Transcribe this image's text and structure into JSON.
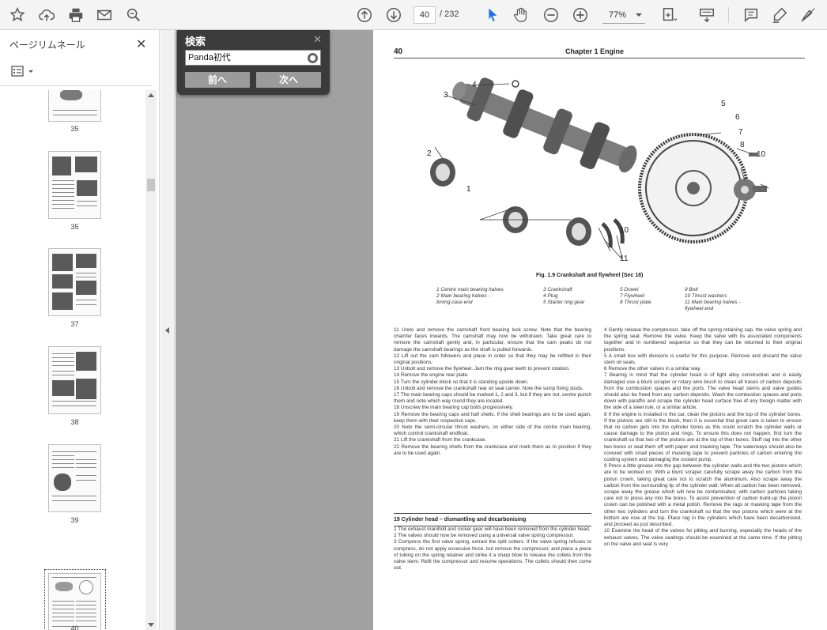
{
  "toolbar": {
    "page_current": "40",
    "page_total": "/ 232",
    "zoom": "77%"
  },
  "left_panel": {
    "title": "ページリムネール",
    "thumbnails": [
      {
        "label": "35"
      },
      {
        "label": "35"
      },
      {
        "label": "37"
      },
      {
        "label": "38"
      },
      {
        "label": "39"
      },
      {
        "label": "40"
      }
    ]
  },
  "search": {
    "title": "検索",
    "query": "Panda初代",
    "prev_label": "前へ",
    "next_label": "次へ"
  },
  "document": {
    "page_number": "40",
    "chapter": "Chapter 1  Engine",
    "figure_caption": "Fig. 1.9 Crankshaft and flywheel (Sec 18)",
    "callouts": [
      "4",
      "3",
      "2",
      "1",
      "5",
      "6",
      "7",
      "8",
      "10",
      "10",
      "11"
    ],
    "legend": [
      "1   Centre main bearing halves",
      "2   Main bearing halves -",
      "     timing case end",
      "3   Crankshaft",
      "4   Plug",
      "5   Starter ring gear",
      "5   Dowel",
      "7   Flywheel",
      "8   Thrust plate",
      "9   Bolt",
      "10  Thrust washers",
      "11  Main bearing halves -",
      "      flywheel end"
    ],
    "left_col_top": "11 Undo and remove the camshaft front bearing lock screw. Note that the bearing chamfer faces inwards. The camshaft may now be withdrawn. Take great care to remove the camshaft gently and, in particular, ensure that the cam peaks do not damage the camshaft bearings as the shaft is pulled forwards.\n12 Lift out the cam followers and place in order so that they may be refitted in their original positions.\n13 Unbolt and remove the flywheel. Jam the ring gear teeth to prevent rotation.\n14 Remove the engine rear plate.\n15 Turn the cylinder block so that it is standing upside down.\n16 Unbolt and remove the crankshaft rear oil seal carrier. Note the sump fixing studs.\n17 The main bearing caps should be marked 1, 2 and 3, but if they are not, centre punch them and note which way round they are located.\n18 Unscrew the main bearing cap bolts progressively.\n19 Remove the bearing caps and half shells. If the shell bearings are to be used again, keep them with their respective caps.\n20 Note the semi-circular thrust washers, on either side of the centre main bearing, which control crankshaft endfloat.\n21 Lift the crankshaft from the crankcase.\n22 Remove the bearing shells from the crankcase and mark them as to position if they are to be used again.",
    "section_heading": "19  Cylinder head – dismantling and decarbonising",
    "left_col_bottom": "1   The exhaust manifold and rocker gear will have been removed from the cylinder head.\n2   The valves should now be removed using a universal valve spring compressor.\n3   Compress the first valve spring, extract the split cotters. If the valve spring refuses to compress, do not apply excessive force, but remove the compressor, and place a piece of tubing on the spring retainer and strike it a sharp blow to release the collets from the valve stem. Refit the compressor and resume operations. The collets should then come out.",
    "right_col": "4   Gently release the compressor, take off the spring retaining cap, the valve spring and the spring seat. Remove the valve. Keep the valve with its associated components together and in numbered sequence so that they can be returned to their original positions.\n5   A small box with divisions is useful for this purpose. Remove and discard the valve stem oil seals.\n6   Remove the other valves in a similar way.\n7   Bearing in mind that the cylinder head is of light alloy construction and is easily damaged use a blunt scraper or rotary wire brush to clean all traces of carbon deposits from the combustion spaces and the ports. The valve head stems and valve guides should also be freed from any carbon deposits. Wash the combustion spaces and ports down with paraffin and scrape the cylinder head surface free of any foreign matter with the side of a steel rule, or a similar article.\n8   If the engine is installed in the car, clean the pistons and the top of the cylinder bores. If the pistons are still in the block, then it is essential that great care is taken to ensure that no carbon gets into the cylinder bores as this could scratch the cylinder walls or cause damage to the piston and rings. To ensure this does not happen, first turn the crankshaft so that two of the pistons are at the top of their bores. Stuff rag into the other two bores or seal them off with paper and masking tape. The waterways should also be covered with small pieces of masking tape to prevent particles of carbon entering the cooling system and damaging the coolant pump.\n9   Press a little grease into the gap between the cylinder walls and the two pistons which are to be worked on. With a blunt scraper carefully scrape away the carbon from the piston crown, taking great care not to scratch the aluminium. Also scrape away the carbon from the surrounding lip of the cylinder wall. When all carbon has been removed, scrape away the grease which will now be contaminated, with carbon particles taking care not to press any into the bores. To assist prevention of carbon build-up the piston crown can be polished with a metal polish. Remove the rags or masking tape from the other two cylinders and turn the crankshaft so that the two pistons which were at the bottom are now at the top. Place rag in the cylinders which have been decarbonised, and proceed as just described.\n10  Examine the head of the valves for pitting and burning, especially the heads of the exhaust valves. The valve seatings should be examined at the same time. If the pitting on the valve and seat is very"
  }
}
